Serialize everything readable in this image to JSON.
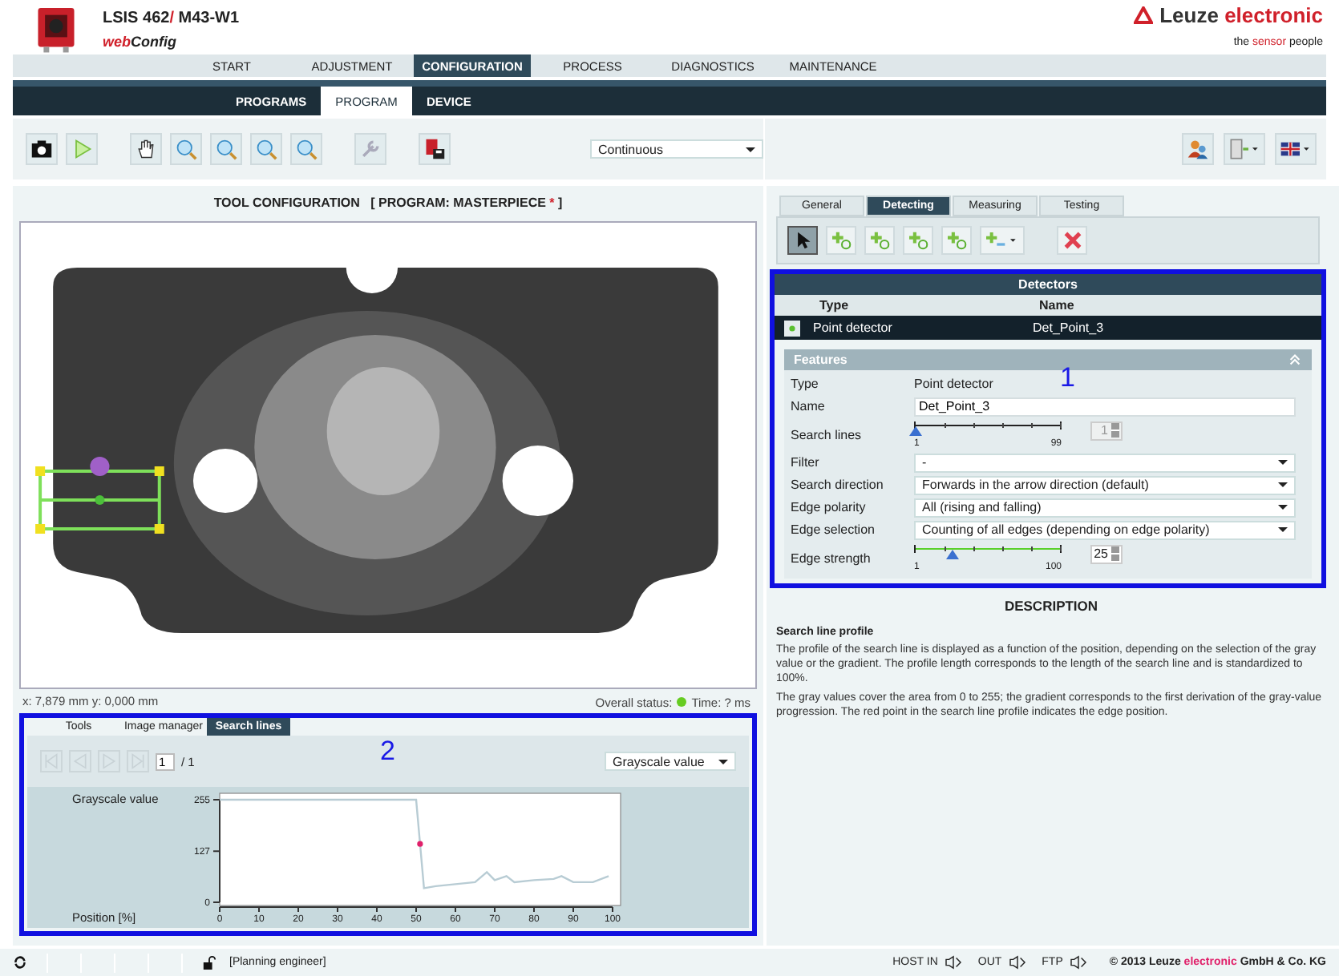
{
  "header": {
    "title": [
      {
        "text": "LSIS 462",
        "accent": false
      },
      {
        "text": "/",
        "accent": true
      },
      {
        "text": " M43-W1",
        "accent": false
      }
    ],
    "app": [
      {
        "text": "web",
        "accent": true
      },
      {
        "text": "Config",
        "accent": false
      }
    ],
    "brand": [
      {
        "text": "Leuze ",
        "accent": false
      },
      {
        "text": "electronic",
        "accent": true
      }
    ],
    "tagline": [
      {
        "text": "the ",
        "accent": false
      },
      {
        "text": "sensor",
        "accent": true
      },
      {
        "text": " people",
        "accent": false
      }
    ]
  },
  "main_tabs": [
    {
      "label": "START",
      "selected": false
    },
    {
      "label": "ADJUSTMENT",
      "selected": false
    },
    {
      "label": "CONFIGURATION",
      "selected": true
    },
    {
      "label": "PROCESS",
      "selected": false
    },
    {
      "label": "DIAGNOSTICS",
      "selected": false
    },
    {
      "label": "MAINTENANCE",
      "selected": false
    }
  ],
  "sub_tabs": [
    {
      "label": "PROGRAMS",
      "selected": false
    },
    {
      "label": "PROGRAM",
      "selected": true
    },
    {
      "label": "DEVICE",
      "selected": false
    }
  ],
  "toolbar": {
    "mode": "Continuous"
  },
  "tool_configuration": {
    "title": "TOOL CONFIGURATION",
    "program": [
      {
        "text": "[ PROGRAM: MASTERPIECE ",
        "accent": false
      },
      {
        "text": "*",
        "accent": true
      },
      {
        "text": " ]",
        "accent": false
      }
    ],
    "coordinates": "x: 7,879 mm y: 0,000 mm",
    "status_label": "Overall status:",
    "time": "Time: ? ms"
  },
  "bottom_panel": {
    "tabs": [
      {
        "label": "Tools",
        "selected": false
      },
      {
        "label": "Image manager",
        "selected": false
      },
      {
        "label": "Search lines",
        "selected": true
      }
    ],
    "page": "1",
    "page_total": "/ 1",
    "mode": "Grayscale value",
    "chart_data": {
      "type": "line",
      "xlabel": "Position [%]",
      "ylabel": "Grayscale value",
      "xlim": [
        0,
        100
      ],
      "ylim": [
        0,
        255
      ],
      "xticks": [
        0,
        10,
        20,
        30,
        40,
        50,
        60,
        70,
        80,
        90,
        100
      ],
      "yticks": [
        0,
        127,
        255
      ],
      "x": [
        0,
        5,
        10,
        15,
        20,
        25,
        30,
        35,
        40,
        45,
        50,
        52,
        55,
        60,
        65,
        68,
        70,
        73,
        75,
        80,
        85,
        87,
        90,
        95,
        99
      ],
      "series": [
        {
          "color": "#b8ccd4",
          "values": [
            255,
            255,
            255,
            255,
            255,
            255,
            255,
            255,
            255,
            255,
            255,
            35,
            40,
            45,
            50,
            75,
            55,
            65,
            50,
            55,
            58,
            65,
            50,
            50,
            65
          ]
        }
      ]
    }
  },
  "callouts": [
    {
      "label": "1"
    },
    {
      "label": "2"
    }
  ],
  "right_tabs": [
    {
      "label": "General",
      "selected": false
    },
    {
      "label": "Detecting",
      "selected": true
    },
    {
      "label": "Measuring",
      "selected": false
    },
    {
      "label": "Testing",
      "selected": false
    }
  ],
  "detectors": {
    "title": "Detectors",
    "columns": [
      "Type",
      "Name"
    ],
    "rows": [
      {
        "type": "Point detector",
        "name": "Det_Point_3",
        "selected": true
      }
    ]
  },
  "features": {
    "title": "Features",
    "expanded": true,
    "fields": [
      {
        "kind": "text",
        "label": "Type",
        "value": "Point detector"
      },
      {
        "kind": "input",
        "label": "Name",
        "value": "Det_Point_3"
      },
      {
        "kind": "slider",
        "label": "Search lines",
        "min": "1",
        "max": "99",
        "level": 0,
        "value": "1",
        "disabled": true
      },
      {
        "kind": "select",
        "label": "Filter",
        "value": "-"
      },
      {
        "kind": "select",
        "label": "Search direction",
        "value": "Forwards in the arrow direction (default)"
      },
      {
        "kind": "select",
        "label": "Edge polarity",
        "value": "All (rising and falling)"
      },
      {
        "kind": "select",
        "label": "Edge selection",
        "value": "Counting of all edges (depending on edge polarity)"
      },
      {
        "kind": "slider",
        "label": "Edge strength",
        "min": "1",
        "max": "100",
        "level": 0.25,
        "value": "25",
        "disabled": false
      }
    ]
  },
  "description": {
    "title": "DESCRIPTION",
    "subtitle": "Search line profile",
    "paragraphs": [
      "The profile of the search line is displayed as a function of the position, depending on the selection of the gray value or the gradient. The profile length corresponds to the length of the search line and is standardized to 100%.",
      "The gray values cover the area from 0 to 255; the gradient corresponds to the first derivation of the gray-value progression. The red point in the search line profile indicates the edge position."
    ]
  },
  "status_bar": {
    "user": "[Planning engineer]",
    "channels": [
      "HOST IN",
      "OUT",
      "FTP"
    ],
    "copyright": [
      {
        "text": "© 2013 Leuze ",
        "accent": false
      },
      {
        "text": "electronic",
        "accent": true
      },
      {
        "text": " GmbH & Co. KG",
        "accent": false
      }
    ]
  }
}
